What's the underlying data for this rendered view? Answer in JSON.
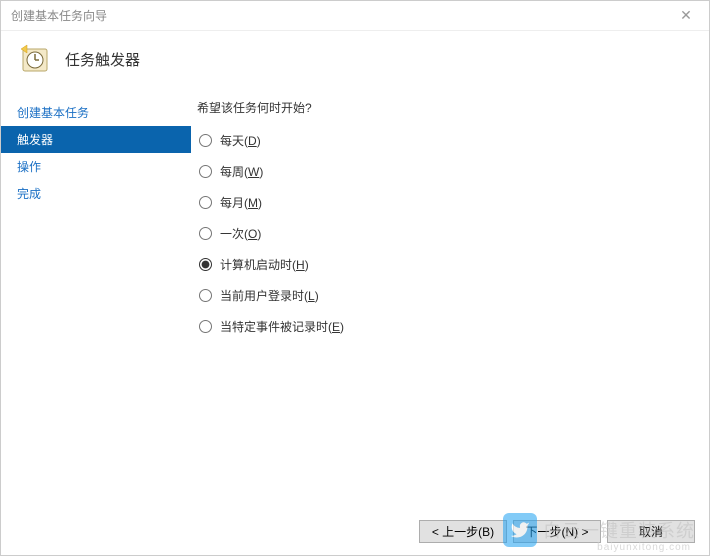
{
  "window": {
    "title": "创建基本任务向导"
  },
  "header": {
    "heading": "任务触发器"
  },
  "sidebar": {
    "items": [
      {
        "label": "创建基本任务",
        "selected": false
      },
      {
        "label": "触发器",
        "selected": true
      },
      {
        "label": "操作",
        "selected": false
      },
      {
        "label": "完成",
        "selected": false
      }
    ]
  },
  "main": {
    "prompt": "希望该任务何时开始?",
    "options": [
      {
        "text": "每天",
        "accel": "D",
        "checked": false
      },
      {
        "text": "每周",
        "accel": "W",
        "checked": false
      },
      {
        "text": "每月",
        "accel": "M",
        "checked": false
      },
      {
        "text": "一次",
        "accel": "O",
        "checked": false
      },
      {
        "text": "计算机启动时",
        "accel": "H",
        "checked": true
      },
      {
        "text": "当前用户登录时",
        "accel": "L",
        "checked": false
      },
      {
        "text": "当特定事件被记录时",
        "accel": "E",
        "checked": false
      }
    ]
  },
  "footer": {
    "back": "< 上一步(B)",
    "next": "下一步(N) >",
    "cancel": "取消"
  },
  "watermark": {
    "text": "白云一键重装系统",
    "sub": "baiyunxitong.com"
  }
}
